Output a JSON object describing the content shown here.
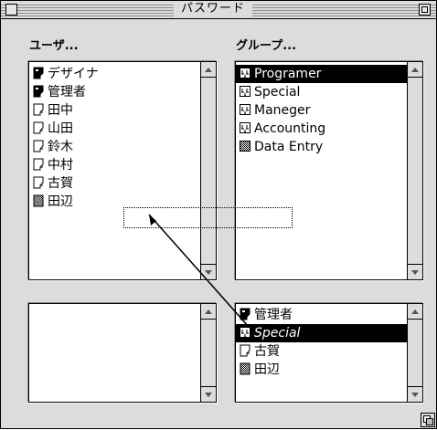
{
  "window": {
    "title": "パスワード"
  },
  "users_label": "ユーザ...",
  "groups_label": "グループ...",
  "users": [
    {
      "name": "デザイナ",
      "icon": "group-user-icon"
    },
    {
      "name": "管理者",
      "icon": "group-user-icon"
    },
    {
      "name": "田中",
      "icon": "user-icon"
    },
    {
      "name": "山田",
      "icon": "user-icon"
    },
    {
      "name": "鈴木",
      "icon": "user-icon"
    },
    {
      "name": "中村",
      "icon": "user-icon"
    },
    {
      "name": "古賀",
      "icon": "user-icon"
    },
    {
      "name": "田辺",
      "icon": "guest-user-icon"
    }
  ],
  "groups": [
    {
      "name": "Programer",
      "icon": "group-icon",
      "selected": true
    },
    {
      "name": "Special",
      "icon": "group-icon"
    },
    {
      "name": "Maneger",
      "icon": "group-icon"
    },
    {
      "name": "Accounting",
      "icon": "group-icon"
    },
    {
      "name": "Data Entry",
      "icon": "everyone-group-icon"
    }
  ],
  "members": [
    {
      "name": "管理者",
      "icon": "group-user-icon"
    },
    {
      "name": "Special",
      "icon": "group-icon",
      "selected": true,
      "italic": true
    },
    {
      "name": "古賀",
      "icon": "user-icon"
    },
    {
      "name": "田辺",
      "icon": "guest-user-icon"
    }
  ],
  "colors": {
    "selection": "#000000",
    "window_bg": "#dcdcdc"
  }
}
